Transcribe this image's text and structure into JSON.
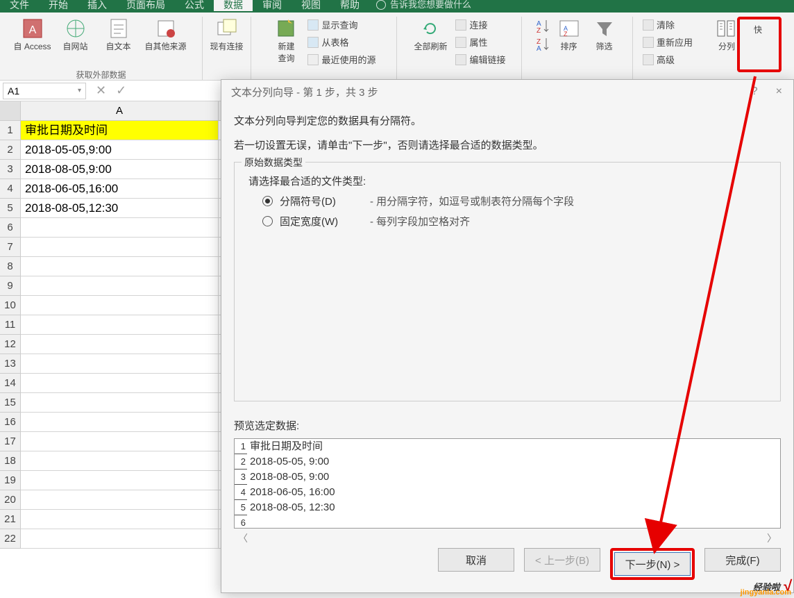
{
  "menu": {
    "file": "文件",
    "start": "开始",
    "insert": "插入",
    "layout": "页面布局",
    "formula": "公式",
    "data": "数据",
    "review": "审阅",
    "view": "视图",
    "help": "帮助",
    "tell": "告诉我您想要做什么"
  },
  "ribbon": {
    "access": "自 Access",
    "web": "自网站",
    "text": "自文本",
    "other": "自其他来源",
    "existing": "现有连接",
    "newquery": "新建\n查询",
    "showquery": "显示查询",
    "fromtable": "从表格",
    "recent": "最近使用的源",
    "refresh": "全部刷新",
    "connect": "连接",
    "prop": "属性",
    "editlink": "编辑链接",
    "azsort": "排序",
    "filter": "筛选",
    "clear": "清除",
    "reapply": "重新应用",
    "advanced": "高级",
    "split": "分列",
    "quick": "快",
    "group1": "获取外部数据"
  },
  "namebox": "A1",
  "sheet": {
    "colA": "A",
    "rows": [
      {
        "n": "1",
        "v": "审批日期及时间",
        "hdr": true
      },
      {
        "n": "2",
        "v": "2018-05-05,9:00"
      },
      {
        "n": "3",
        "v": "2018-08-05,9:00"
      },
      {
        "n": "4",
        "v": "2018-06-05,16:00"
      },
      {
        "n": "5",
        "v": "2018-08-05,12:30"
      },
      {
        "n": "6",
        "v": ""
      },
      {
        "n": "7",
        "v": ""
      },
      {
        "n": "8",
        "v": ""
      },
      {
        "n": "9",
        "v": ""
      },
      {
        "n": "10",
        "v": ""
      },
      {
        "n": "11",
        "v": ""
      },
      {
        "n": "12",
        "v": ""
      },
      {
        "n": "13",
        "v": ""
      },
      {
        "n": "14",
        "v": ""
      },
      {
        "n": "15",
        "v": ""
      },
      {
        "n": "16",
        "v": ""
      },
      {
        "n": "17",
        "v": ""
      },
      {
        "n": "18",
        "v": ""
      },
      {
        "n": "19",
        "v": ""
      },
      {
        "n": "20",
        "v": ""
      },
      {
        "n": "21",
        "v": ""
      },
      {
        "n": "22",
        "v": ""
      }
    ]
  },
  "dialog": {
    "title": "文本分列向导 - 第 1 步，共 3 步",
    "help": "?",
    "close": "×",
    "line1": "文本分列向导判定您的数据具有分隔符。",
    "line2": "若一切设置无误，请单击\"下一步\"，否则请选择最合适的数据类型。",
    "fs_title": "原始数据类型",
    "fs_hint": "请选择最合适的文件类型:",
    "r1": "分隔符号(D)",
    "r1b": "- 用分隔字符，如逗号或制表符分隔每个字段",
    "r2": "固定宽度(W)",
    "r2b": "- 每列字段加空格对齐",
    "prev_label": "预览选定数据:",
    "preview": [
      {
        "n": "1",
        "t": "审批日期及时间"
      },
      {
        "n": "2",
        "t": "2018-05-05, 9:00"
      },
      {
        "n": "3",
        "t": "2018-08-05, 9:00"
      },
      {
        "n": "4",
        "t": "2018-06-05, 16:00"
      },
      {
        "n": "5",
        "t": "2018-08-05, 12:30"
      },
      {
        "n": "6",
        "t": ""
      }
    ],
    "btn_cancel": "取消",
    "btn_prev": "< 上一步(B)",
    "btn_next": "下一步(N) >",
    "btn_finish": "完成(F)"
  },
  "watermark": {
    "txt": "经验啦",
    "url": "jingyanla.com"
  }
}
